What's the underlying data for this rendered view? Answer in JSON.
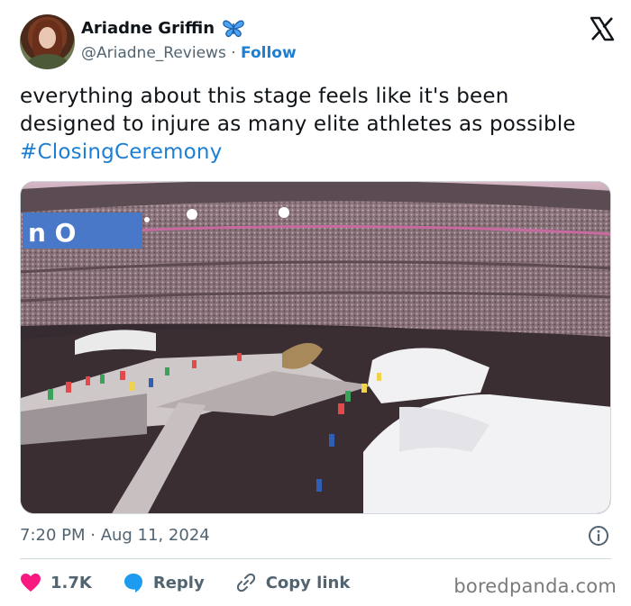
{
  "author": {
    "display_name": "Ariadne Griffin",
    "handle": "@Ariadne_Reviews",
    "separator": " · ",
    "follow_label": "Follow",
    "badge_icon": "butterfly-icon"
  },
  "brand": {
    "logo_icon": "x-logo-icon",
    "accent": "#1d7fd4"
  },
  "tweet": {
    "text": "everything about this stage feels like it's been designed to injure as many elite athletes as possible ",
    "hashtag": "#ClosingCeremony"
  },
  "media": {
    "kind": "stadium-ceremony-photo",
    "screen_text": "n O"
  },
  "meta": {
    "timestamp": "7:20 PM · Aug 11, 2024"
  },
  "actions": {
    "like_count": "1.7K",
    "reply_label": "Reply",
    "copy_label": "Copy link",
    "like_color": "#f91880",
    "reply_color": "#1d9bf0"
  },
  "watermark": "boredpanda.com"
}
